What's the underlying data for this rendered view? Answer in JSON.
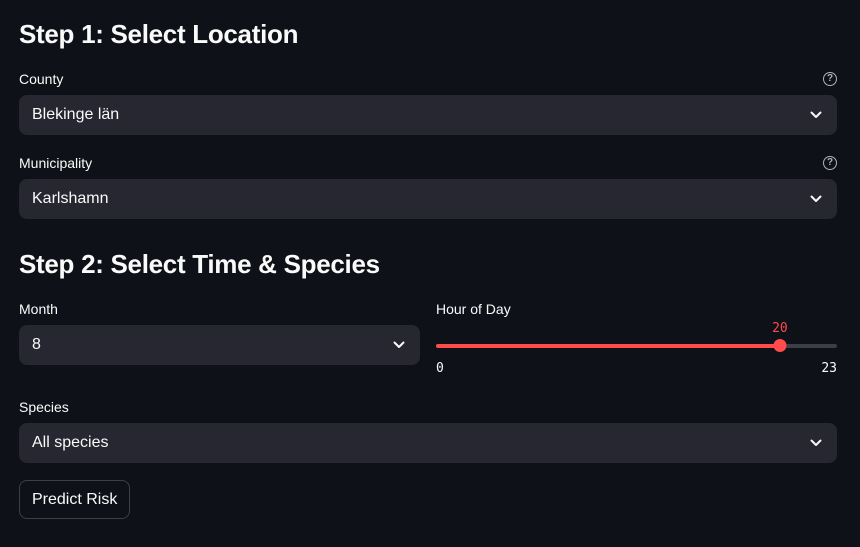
{
  "step1": {
    "title": "Step 1: Select Location",
    "county": {
      "label": "County",
      "value": "Blekinge län"
    },
    "municipality": {
      "label": "Municipality",
      "value": "Karlshamn"
    }
  },
  "step2": {
    "title": "Step 2: Select Time & Species",
    "month": {
      "label": "Month",
      "value": "8"
    },
    "hour": {
      "label": "Hour of Day",
      "value": "20",
      "min": "0",
      "max": "23"
    },
    "species": {
      "label": "Species",
      "value": "All species"
    }
  },
  "actions": {
    "predict_label": "Predict Risk"
  },
  "icons": {
    "help": "help-circle-icon",
    "dropdown": "chevron-down-icon"
  },
  "colors": {
    "background": "#0e1117",
    "input_bg": "#262730",
    "accent": "#ff4b4b",
    "text": "#fafafa"
  }
}
